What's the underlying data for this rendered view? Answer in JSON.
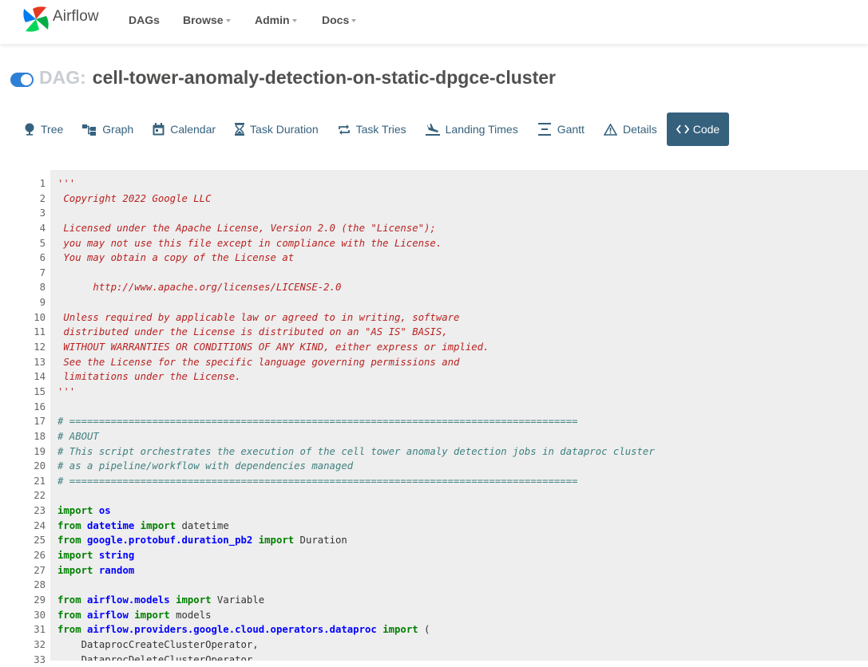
{
  "brand": {
    "name": "Airflow"
  },
  "nav": {
    "dags": "DAGs",
    "browse": "Browse",
    "admin": "Admin",
    "docs": "Docs"
  },
  "dag": {
    "label": "DAG:",
    "name": "cell-tower-anomaly-detection-on-static-dpgce-cluster",
    "paused": false
  },
  "colors": {
    "accent": "#36617d",
    "toggle": "#2e80d6",
    "code_bg": "#eeeeee"
  },
  "tabs": [
    {
      "label": "Tree",
      "icon": "tree-icon"
    },
    {
      "label": "Graph",
      "icon": "graph-icon"
    },
    {
      "label": "Calendar",
      "icon": "calendar-icon"
    },
    {
      "label": "Task Duration",
      "icon": "hourglass-icon"
    },
    {
      "label": "Task Tries",
      "icon": "retry-icon"
    },
    {
      "label": "Landing Times",
      "icon": "landing-icon"
    },
    {
      "label": "Gantt",
      "icon": "gantt-icon"
    },
    {
      "label": "Details",
      "icon": "warning-triangle-icon"
    },
    {
      "label": "Code",
      "icon": "code-icon",
      "active": true
    }
  ],
  "code": {
    "line_numbers": [
      "1",
      "2",
      "3",
      "4",
      "5",
      "6",
      "7",
      "8",
      "9",
      "10",
      "11",
      "12",
      "13",
      "14",
      "15",
      "16",
      "17",
      "18",
      "19",
      "20",
      "21",
      "22",
      "23",
      "24",
      "25",
      "26",
      "27",
      "28",
      "29",
      "30",
      "31",
      "32",
      "33"
    ],
    "lines": [
      "'''",
      " Copyright 2022 Google LLC",
      "",
      " Licensed under the Apache License, Version 2.0 (the \"License\");",
      " you may not use this file except in compliance with the License.",
      " You may obtain a copy of the License at",
      "",
      "      http://www.apache.org/licenses/LICENSE-2.0",
      "",
      " Unless required by applicable law or agreed to in writing, software",
      " distributed under the License is distributed on an \"AS IS\" BASIS,",
      " WITHOUT WARRANTIES OR CONDITIONS OF ANY KIND, either express or implied.",
      " See the License for the specific language governing permissions and",
      " limitations under the License.",
      "'''",
      "",
      "# ======================================================================================",
      "# ABOUT",
      "# This script orchestrates the execution of the cell tower anomaly detection jobs in dataproc cluster",
      "# as a pipeline/workflow with dependencies managed",
      "# ======================================================================================",
      "",
      "import os",
      "from datetime import datetime",
      "from google.protobuf.duration_pb2 import Duration",
      "import string",
      "import random",
      "",
      "from airflow.models import Variable",
      "from airflow import models",
      "from airflow.providers.google.cloud.operators.dataproc import (",
      "    DataprocCreateClusterOperator,",
      "    DataprocDeleteClusterOperator,"
    ]
  }
}
